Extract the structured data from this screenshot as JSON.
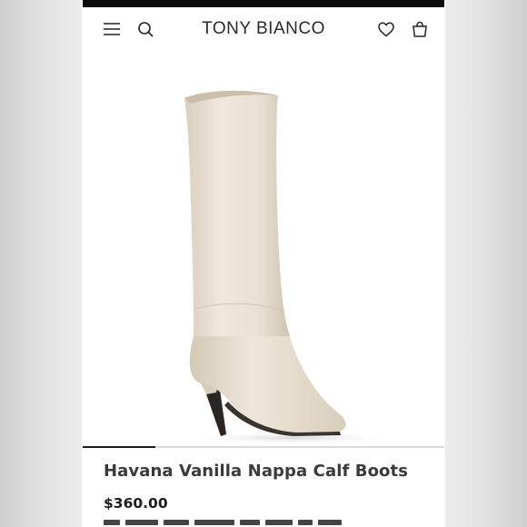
{
  "header": {
    "brand": "TONY BIANCO",
    "icons": {
      "menu": "hamburger-menu-icon",
      "search": "search-icon",
      "wishlist": "heart-icon",
      "bag": "shopping-bag-icon"
    }
  },
  "hero": {
    "image": "cream knee-high stiletto boot",
    "carousel_progress": 0.2
  },
  "product": {
    "title": "Havana Vanilla Nappa Calf Boots",
    "price": "$360.00"
  },
  "colors": {
    "boot": "#e8e0d2",
    "text": "#3a3a3a",
    "status_bar": "#0b0b0b"
  }
}
